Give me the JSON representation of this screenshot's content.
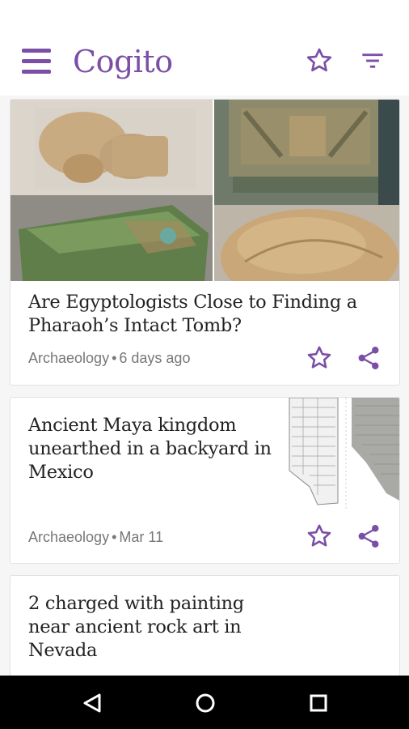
{
  "app": {
    "title": "Cogito",
    "accent_color": "#7b4fa6",
    "icons": {
      "menu": "hamburger-menu-icon",
      "favorites": "star-outline-icon",
      "filter": "filter-icon"
    }
  },
  "feed": {
    "articles": [
      {
        "title": "Are Egyptologists Close to Finding a Pharaoh’s Intact Tomb?",
        "category": "Archaeology",
        "separator": "•",
        "time": "6 days ago",
        "image": "egyptian-artifacts-collage",
        "icons": [
          "star-outline-icon",
          "share-icon"
        ]
      },
      {
        "title": "Ancient Maya kingdom unearthed in a backyard in Mexico",
        "category": "Archaeology",
        "separator": "•",
        "time": "Mar 11",
        "image": "maya-glyph-drawing-thumbnail",
        "icons": [
          "star-outline-icon",
          "share-icon"
        ]
      },
      {
        "title": "2 charged with painting near ancient rock art in Nevada"
      }
    ]
  },
  "system_nav": {
    "icons": [
      "back-icon",
      "home-icon",
      "recents-icon"
    ]
  }
}
